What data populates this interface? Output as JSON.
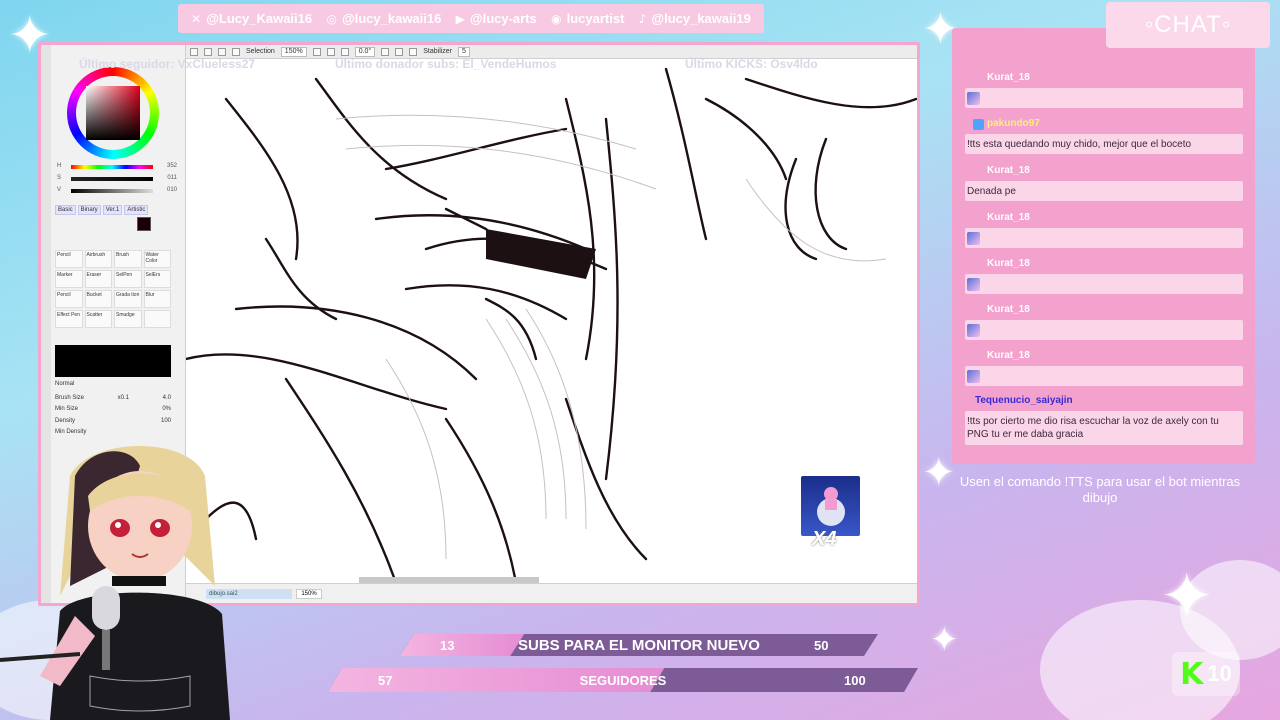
{
  "social_bar": [
    {
      "icon": "x-icon",
      "glyph": "✕",
      "handle": "@Lucy_Kawaii16"
    },
    {
      "icon": "instagram-icon",
      "glyph": "◎",
      "handle": "@lucy_kawaii16"
    },
    {
      "icon": "youtube-icon",
      "glyph": "▶",
      "handle": "@lucy-arts"
    },
    {
      "icon": "discord-icon",
      "glyph": "◉",
      "handle": "lucyartist"
    },
    {
      "icon": "tiktok-icon",
      "glyph": "♪",
      "handle": "@lucy_kawaii19"
    }
  ],
  "overlay": {
    "last_follower": "Último seguidor: VxClueless27",
    "last_donor": "Último donador subs: El_VendeHumos",
    "last_kicks": "Último KICKS: Osv4ldo"
  },
  "app": {
    "toolbar": {
      "selection_label": "Selection",
      "zoom": "150%",
      "rotation": "0.0°",
      "stabilizer_label": "Stabilizer",
      "stabilizer_value": "5"
    },
    "color": {
      "h_label": "H",
      "h_value": "352",
      "s_label": "S",
      "s_value": "011",
      "v_label": "V",
      "v_value": "010",
      "primary": "#e0001a"
    },
    "tool_tabs": [
      "Basic",
      "Binary",
      "Ver.1",
      "Artistic"
    ],
    "tools": [
      "Pencil",
      "Airbrush",
      "Brush",
      "Water Color",
      "Marker",
      "Eraser",
      "SelPen",
      "SelErs",
      "Pencil",
      "Bucket",
      "Grada tion",
      "Blur",
      "Effect Pen",
      "Scatter",
      "Smudge",
      ""
    ],
    "blend_mode": "Normal",
    "brush_size_label": "Brush Size",
    "brush_size_mult": "x0.1",
    "brush_size_value": "4.0",
    "min_size_label": "Min Size",
    "min_size_value": "0%",
    "density_label": "Density",
    "density_value": "100",
    "min_density_label": "Min Density",
    "file_tab": "dibujo.sai2",
    "status_zoom": "150%"
  },
  "sticker": {
    "count": "X4"
  },
  "chat": {
    "title": "◦CHAT◦",
    "messages": [
      {
        "user": "Kurat_18",
        "user_color": "#ffffff",
        "text": "",
        "emote": true,
        "badge": false
      },
      {
        "user": "pakundo97",
        "user_color": "#f8f07a",
        "text": "!tts esta quedando muy chido, mejor que el boceto",
        "emote": false,
        "badge": true
      },
      {
        "user": "Kurat_18",
        "user_color": "#ffffff",
        "text": "Denada pe",
        "emote": false,
        "badge": false
      },
      {
        "user": "Kurat_18",
        "user_color": "#ffffff",
        "text": "",
        "emote": true,
        "badge": false
      },
      {
        "user": "Kurat_18",
        "user_color": "#ffffff",
        "text": "",
        "emote": true,
        "badge": false
      },
      {
        "user": "Kurat_18",
        "user_color": "#ffffff",
        "text": "",
        "emote": true,
        "badge": false
      },
      {
        "user": "Kurat_18",
        "user_color": "#ffffff",
        "text": "",
        "emote": true,
        "badge": false
      },
      {
        "user": "Tequenucio_saiyajin",
        "user_color": "#3a2bd0",
        "text": "!tts por cierto me dio risa escuchar la voz de axely con tu PNG tu er me daba gracia",
        "emote": false,
        "badge": false
      }
    ],
    "hint": "Usen el comando !TTS para usar el bot mientras dibujo"
  },
  "goals": {
    "subs": {
      "current": "13",
      "label": "SUBS PARA EL MONITOR NUEVO",
      "target": "50",
      "fraction": 0.26
    },
    "followers": {
      "current": "57",
      "label": "SEGUIDORES",
      "target": "100",
      "fraction": 0.57
    }
  },
  "kick": {
    "logo": "K",
    "count": "10",
    "brand_color": "#53fc18"
  }
}
